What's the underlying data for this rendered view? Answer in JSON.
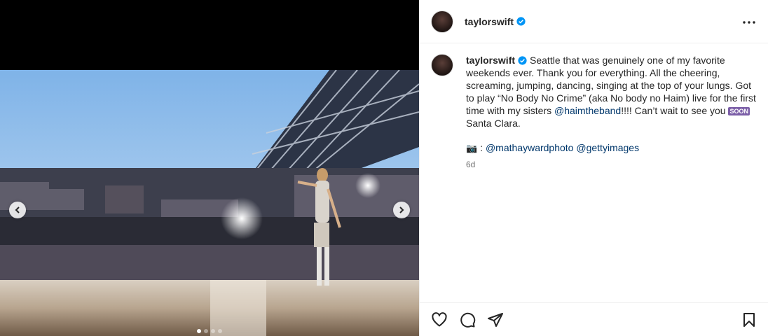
{
  "post": {
    "username": "taylorswift",
    "caption_text_1": "Seattle that was genuinely one of my favorite weekends ever. Thank you for everything. All the cheering, screaming, jumping, dancing, singing at the top of your lungs. Got to play “No Body No Crime” (aka No body no Haim) live for the first time with my sisters ",
    "caption_mention": "@haimtheband",
    "caption_text_2": "!!!! Can’t wait to see you ",
    "soon_emoji": "SOON",
    "caption_text_3": " Santa Clara.",
    "credit_prefix": ": ",
    "credit_mention_1": "@mathaywardphoto",
    "credit_mention_2": "@gettyimages",
    "timestamp": "6d"
  },
  "icons": {
    "header": [
      "verified-badge-icon",
      "more-options-icon"
    ],
    "media": [
      "chevron-left-icon",
      "chevron-right-icon"
    ],
    "actions": [
      "heart-icon",
      "comment-icon",
      "share-icon",
      "bookmark-icon"
    ]
  },
  "carousel": {
    "slides": 4,
    "active": 1
  },
  "colors": {
    "verified": "#0095f6",
    "mention": "#00376b",
    "timestamp": "#737373",
    "divider": "#efefef"
  }
}
